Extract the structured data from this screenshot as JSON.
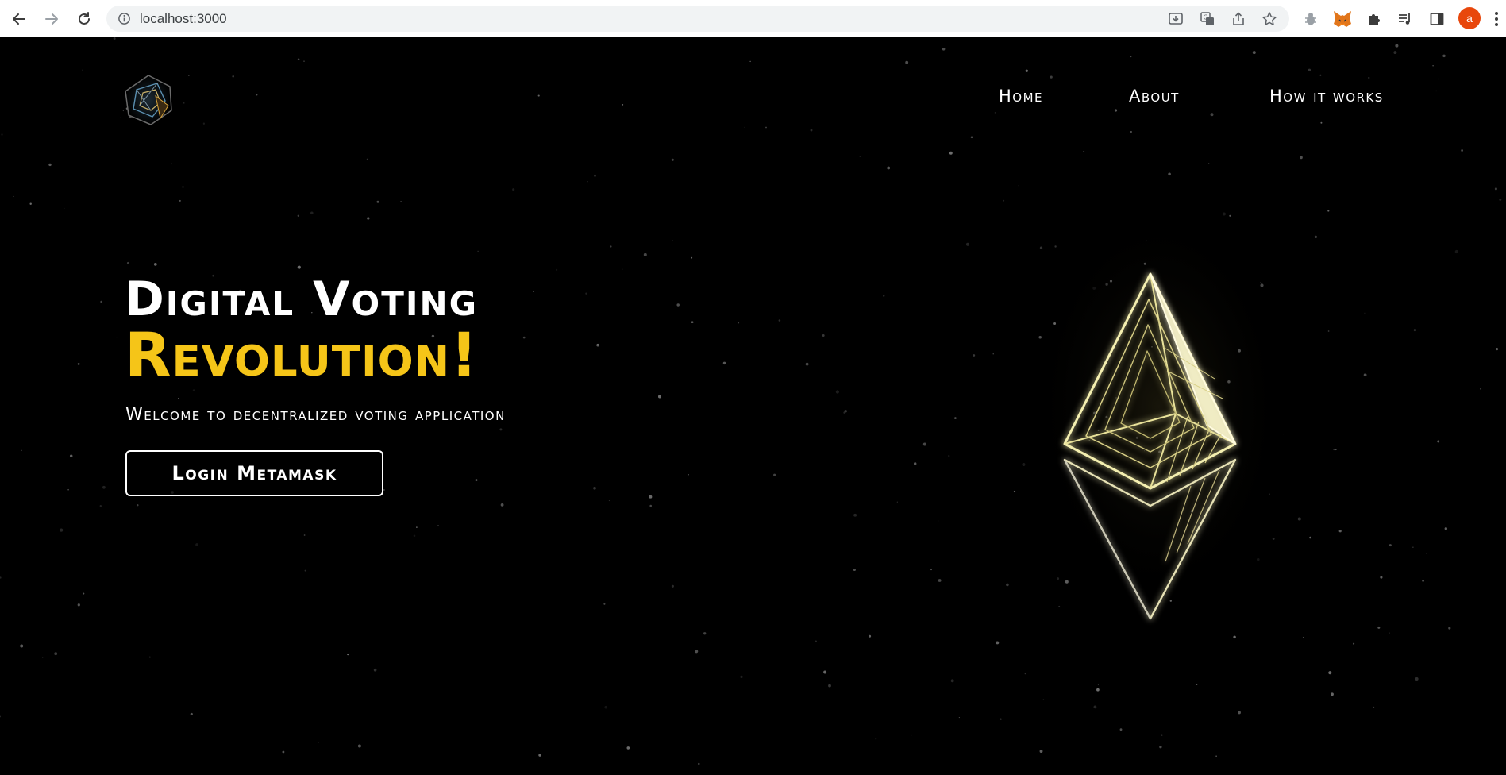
{
  "browser": {
    "url": "localhost:3000",
    "avatar_letter": "a",
    "icons": {
      "back": "arrow-left-icon",
      "forward": "arrow-right-icon",
      "reload": "reload-icon",
      "site_info": "info-icon",
      "install": "install-icon",
      "translate": "translate-icon",
      "share": "share-icon",
      "bookmark": "star-icon",
      "extension_bug": "bug-icon",
      "metamask": "fox-icon",
      "extensions": "puzzle-icon",
      "media": "playlist-icon",
      "side_panel": "side-panel-icon",
      "menu": "kebab-icon"
    },
    "avatar_color": "#e8470c"
  },
  "nav": {
    "items": [
      {
        "label": "Home"
      },
      {
        "label": "About"
      },
      {
        "label": "How it works"
      }
    ]
  },
  "hero": {
    "title": "Digital Voting",
    "accent": "Revolution!",
    "subtitle": "Welcome to decentralized voting application",
    "button_label": "Login Metamask"
  },
  "colors": {
    "background": "#000000",
    "accent": "#f5c518",
    "text": "#ffffff"
  }
}
